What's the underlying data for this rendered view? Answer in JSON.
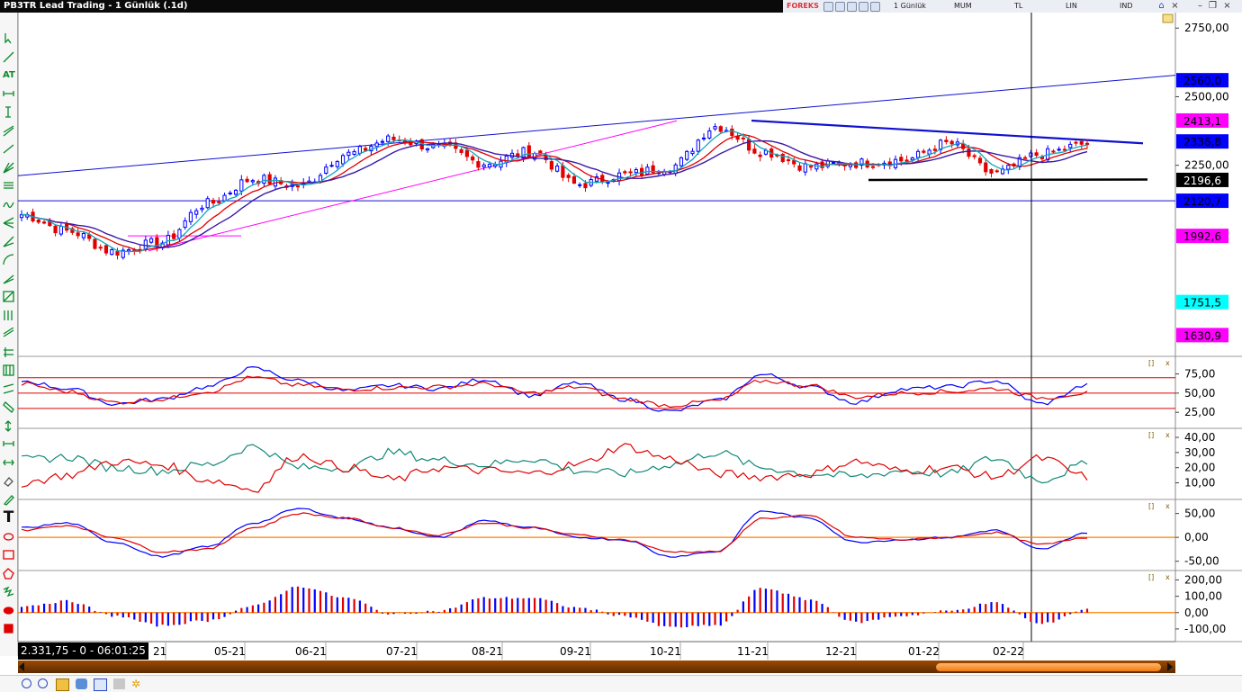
{
  "app": {
    "title": "PB3TR Lead Trading - 1 Günlük (.1d)"
  },
  "toolbar": {
    "brand": "FOREKS",
    "period": "1 Günlük",
    "chart_type": "MUM",
    "currency": "TL",
    "scale": "LIN",
    "indicators": "IND"
  },
  "left_tools": [
    {
      "icon": "pointer-icon"
    },
    {
      "icon": "pen-icon"
    },
    {
      "icon": "text-at-icon",
      "label": "AT"
    },
    {
      "icon": "horizontal-line-icon"
    },
    {
      "icon": "vertical-line-icon"
    },
    {
      "icon": "channel-icon"
    },
    {
      "icon": "trendline-icon"
    },
    {
      "icon": "fibonacci-fan-icon"
    },
    {
      "icon": "fibonacci-retracement-icon"
    },
    {
      "icon": "wave-icon"
    },
    {
      "icon": "andrews-pitchfork-icon"
    },
    {
      "icon": "gann-fan-icon"
    },
    {
      "icon": "fibonacci-arc-icon"
    },
    {
      "icon": "speed-lines-icon"
    },
    {
      "icon": "gann-box-icon"
    },
    {
      "icon": "cycle-lines-icon"
    },
    {
      "icon": "regression-channel-icon"
    },
    {
      "icon": "raff-channel-icon"
    },
    {
      "icon": "gann-grid-icon"
    },
    {
      "icon": "parallel-lines-icon"
    },
    {
      "icon": "ruler-icon"
    },
    {
      "icon": "arrow-up-down-icon"
    },
    {
      "icon": "measure-icon"
    },
    {
      "icon": "range-icon"
    },
    {
      "icon": "eraser-icon"
    },
    {
      "icon": "brush-icon"
    },
    {
      "icon": "text-tool-icon",
      "label": "T"
    },
    {
      "icon": "ellipse-icon"
    },
    {
      "icon": "rectangle-icon"
    },
    {
      "icon": "polygon-icon"
    },
    {
      "icon": "squiggle-icon"
    },
    {
      "icon": "filled-ellipse-icon"
    },
    {
      "icon": "filled-rectangle-icon"
    }
  ],
  "colors": {
    "up": "#0000ff",
    "down": "#e00000",
    "ma_fast": "#10a8b8",
    "ma_mid": "#e00000",
    "ma_slow": "#3a1aa8",
    "trend": "#1010d0",
    "magenta": "#ff00ff",
    "support": "#000000",
    "axis_bg": "#ffffff"
  },
  "price_axis": {
    "ticks": [
      "2750,00",
      "2500,00",
      "2250,00"
    ]
  },
  "price_tags": [
    {
      "text": "2560,0",
      "bg": "#0000ff",
      "fg": "#000000"
    },
    {
      "text": "2413,1",
      "bg": "#ff00ff",
      "fg": "#000000"
    },
    {
      "text": "2336,8",
      "bg": "#0000ff",
      "fg": "#000000"
    },
    {
      "text": "2196,6",
      "bg": "#000000",
      "fg": "#ffffff"
    },
    {
      "text": "2120,7",
      "bg": "#0000ff",
      "fg": "#000000"
    },
    {
      "text": "1992,6",
      "bg": "#ff00ff",
      "fg": "#000000"
    },
    {
      "text": "1751,5",
      "bg": "#00ffff",
      "fg": "#000000"
    },
    {
      "text": "1630,9",
      "bg": "#ff00ff",
      "fg": "#000000"
    }
  ],
  "indicator_axes": [
    {
      "ticks": [
        "75,00",
        "50,00",
        "25,00"
      ]
    },
    {
      "ticks": [
        "40,00",
        "30,00",
        "20,00",
        "10,00"
      ]
    },
    {
      "ticks": [
        "50,00",
        "0,00",
        "-50,00"
      ]
    },
    {
      "ticks": [
        "200,00",
        "100,00",
        "0,00",
        "-100,00"
      ]
    }
  ],
  "time_axis": {
    "labels": [
      "21",
      "05-21",
      "06-21",
      "07-21",
      "08-21",
      "09-21",
      "10-21",
      "11-21",
      "12-21",
      "01-22",
      "02-22"
    ]
  },
  "tooltip": "2.331,75 - 0 - 06:01:25",
  "panel_buttons": {
    "restore": "[]",
    "close": "x"
  },
  "chart_data": {
    "type": "candlestick",
    "interval": "1 Günlük",
    "x_labels": [
      "05-21",
      "06-21",
      "07-21",
      "08-21",
      "09-21",
      "10-21",
      "11-21",
      "12-21",
      "01-22",
      "02-22"
    ],
    "close_anchors": [
      2070,
      2010,
      1935,
      1968,
      2110,
      2200,
      2175,
      2290,
      2345,
      2315,
      2258,
      2300,
      2180,
      2215,
      2245,
      2392,
      2300,
      2245,
      2258,
      2268,
      2330,
      2220,
      2290,
      2328
    ],
    "y_axis": {
      "ticks": [
        2750,
        2500,
        2250
      ],
      "range": [
        1560,
        2800
      ]
    },
    "levels": [
      {
        "name": "2560,0",
        "value": 2560.0
      },
      {
        "name": "2413,1",
        "value": 2413.1
      },
      {
        "name": "2336,8",
        "value": 2336.8
      },
      {
        "name": "2196,6",
        "value": 2196.6
      },
      {
        "name": "2120,7",
        "value": 2120.7
      },
      {
        "name": "1992,6",
        "value": 1992.6
      },
      {
        "name": "1751,5",
        "value": 1751.5
      },
      {
        "name": "1630,9",
        "value": 1630.9
      }
    ],
    "indicators": [
      {
        "type": "line",
        "y_ticks": [
          75,
          50,
          25
        ],
        "bands": [
          70,
          50,
          30
        ],
        "series": [
          {
            "color": "#0000ff",
            "anchors": [
              66,
              56,
              36,
              42,
              58,
              82,
              66,
              53,
              60,
              56,
              68,
              47,
              63,
              42,
              26,
              40,
              74,
              58,
              38,
              55,
              58,
              66,
              36,
              60
            ]
          },
          {
            "color": "#e00000",
            "anchors": [
              62,
              52,
              38,
              42,
              52,
              70,
              60,
              55,
              57,
              58,
              62,
              50,
              58,
              42,
              34,
              40,
              66,
              60,
              45,
              50,
              52,
              56,
              44,
              50
            ]
          }
        ]
      },
      {
        "type": "line",
        "y_ticks": [
          40,
          30,
          20,
          10
        ],
        "series": [
          {
            "color": "#108878",
            "anchors": [
              25,
              27,
              20,
              18,
              22,
              34,
              20,
              20,
              30,
              25,
              22,
              26,
              18,
              16,
              22,
              30,
              20,
              16,
              14,
              18,
              16,
              26,
              12,
              22
            ]
          },
          {
            "color": "#e00000",
            "anchors": [
              10,
              15,
              24,
              22,
              12,
              6,
              28,
              20,
              12,
              20,
              18,
              16,
              22,
              34,
              26,
              16,
              14,
              16,
              24,
              18,
              20,
              14,
              26,
              14
            ]
          }
        ]
      },
      {
        "type": "line",
        "y_ticks": [
          50,
          0,
          -50
        ],
        "zero_line": 0,
        "series": [
          {
            "color": "#0000ff",
            "anchors": [
              20,
              30,
              -10,
              -40,
              -20,
              30,
              60,
              40,
              20,
              0,
              35,
              20,
              0,
              -5,
              -40,
              -30,
              55,
              40,
              -10,
              -5,
              0,
              15,
              -25,
              10
            ]
          },
          {
            "color": "#e00000",
            "anchors": [
              15,
              25,
              0,
              -30,
              -25,
              20,
              50,
              40,
              20,
              5,
              30,
              20,
              5,
              -5,
              -30,
              -30,
              40,
              45,
              0,
              -5,
              0,
              10,
              -15,
              0
            ]
          }
        ]
      },
      {
        "type": "histogram",
        "y_ticks": [
          200,
          100,
          0,
          -100
        ],
        "anchors": [
          40,
          70,
          -20,
          -80,
          -50,
          40,
          160,
          90,
          -10,
          10,
          90,
          90,
          30,
          -20,
          -90,
          -80,
          150,
          80,
          -60,
          -20,
          10,
          60,
          -70,
          20
        ]
      }
    ]
  }
}
